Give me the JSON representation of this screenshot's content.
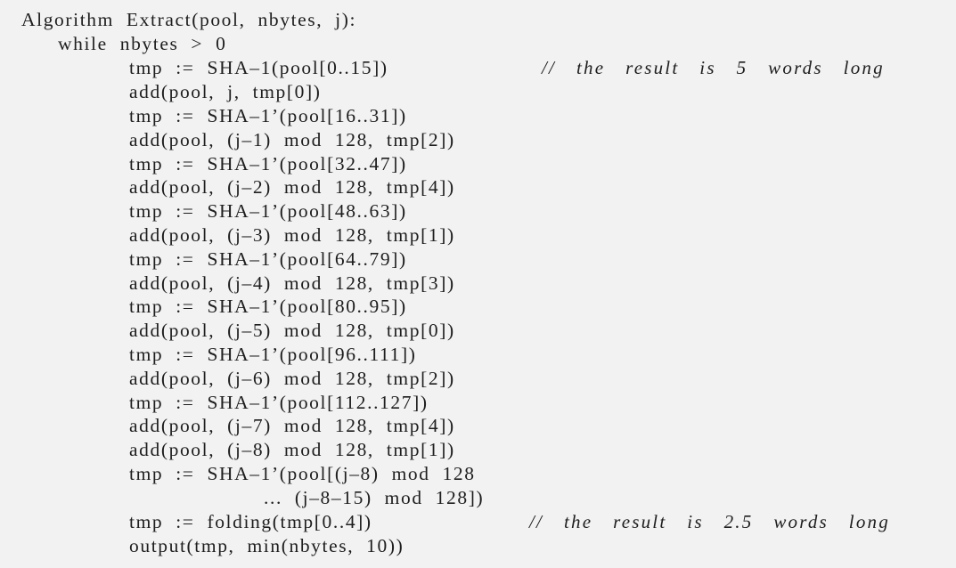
{
  "algorithm": {
    "lines": [
      {
        "text": "Algorithm  Extract(pool,  nbytes,  j):"
      },
      {
        "text": "while  nbytes  >  0"
      },
      {
        "text": "tmp  :=  SHA–1(pool[0..15])",
        "comment": "//  the  result  is  5  words  long"
      },
      {
        "text": "add(pool,  j,  tmp[0])"
      },
      {
        "text": "tmp  :=  SHA–1’(pool[16..31])"
      },
      {
        "text": "add(pool,  (j–1)  mod  128,  tmp[2])"
      },
      {
        "text": "tmp  :=  SHA–1’(pool[32..47])"
      },
      {
        "text": "add(pool,  (j–2)  mod  128,  tmp[4])"
      },
      {
        "text": "tmp  :=  SHA–1’(pool[48..63])"
      },
      {
        "text": "add(pool,  (j–3)  mod  128,  tmp[1])"
      },
      {
        "text": "tmp  :=  SHA–1’(pool[64..79])"
      },
      {
        "text": "add(pool,  (j–4)  mod  128,  tmp[3])"
      },
      {
        "text": "tmp  :=  SHA–1’(pool[80..95])"
      },
      {
        "text": "add(pool,  (j–5)  mod  128,  tmp[0])"
      },
      {
        "text": "tmp  :=  SHA–1’(pool[96..111])"
      },
      {
        "text": "add(pool,  (j–6)  mod  128,  tmp[2])"
      },
      {
        "text": "tmp  :=  SHA–1’(pool[112..127])"
      },
      {
        "text": "add(pool,  (j–7)  mod  128,  tmp[4])"
      },
      {
        "text": "add(pool,  (j–8)  mod  128,  tmp[1])"
      },
      {
        "text": "tmp  :=  SHA–1’(pool[(j–8)  mod  128"
      },
      {
        "text": "...  (j–8–15)  mod  128])"
      },
      {
        "text": "tmp  :=  folding(tmp[0..4])",
        "comment": "//  the  result  is  2.5  words  long"
      },
      {
        "text": "output(tmp,  min(nbytes,  10))"
      }
    ]
  }
}
